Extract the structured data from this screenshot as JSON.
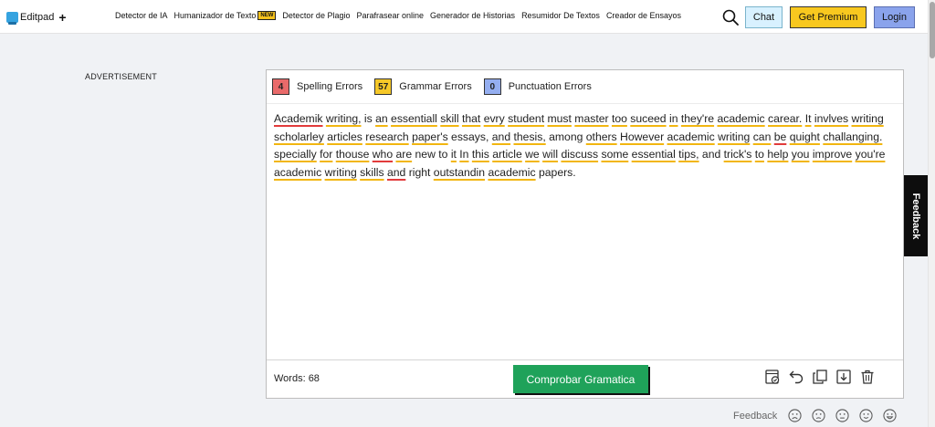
{
  "nav": {
    "logo_text": "Editpad",
    "plus": "+",
    "links": [
      "Detector de IA",
      "Humanizador de Texto"
    ],
    "new_badge": "NEW",
    "links_after": [
      "Detector de Plagio",
      "Parafrasear online",
      "Generador de Historias",
      "Resumidor De Textos",
      "Creador de Ensayos"
    ],
    "chat": "Chat",
    "premium": "Get Premium",
    "login": "Login"
  },
  "ad_label": "ADVERTISEMENT",
  "counts": {
    "spelling": {
      "value": "4",
      "label": "Spelling Errors"
    },
    "grammar": {
      "value": "57",
      "label": "Grammar Errors"
    },
    "punctuation": {
      "value": "0",
      "label": "Punctuation Errors"
    }
  },
  "editor": {
    "tokens": [
      {
        "t": "Academik",
        "m": "s"
      },
      {
        "t": " "
      },
      {
        "t": "writing,",
        "m": "g"
      },
      {
        "t": " is "
      },
      {
        "t": "an",
        "m": "g"
      },
      {
        "t": " "
      },
      {
        "t": "essentiall",
        "m": "g"
      },
      {
        "t": " "
      },
      {
        "t": "skill",
        "m": "g"
      },
      {
        "t": " "
      },
      {
        "t": "that",
        "m": "g"
      },
      {
        "t": " "
      },
      {
        "t": "evry",
        "m": "g"
      },
      {
        "t": " "
      },
      {
        "t": "student",
        "m": "g"
      },
      {
        "t": " "
      },
      {
        "t": "must",
        "m": "g"
      },
      {
        "t": " "
      },
      {
        "t": "master",
        "m": "g"
      },
      {
        "t": " "
      },
      {
        "t": "too",
        "m": "g"
      },
      {
        "t": " "
      },
      {
        "t": "suceed",
        "m": "g"
      },
      {
        "t": " "
      },
      {
        "t": "in",
        "m": "g"
      },
      {
        "t": " "
      },
      {
        "t": "they're",
        "m": "g"
      },
      {
        "t": " "
      },
      {
        "t": "academic",
        "m": "g"
      },
      {
        "t": " "
      },
      {
        "t": "carear.",
        "m": "g"
      },
      {
        "t": " "
      },
      {
        "t": "It",
        "m": "g"
      },
      {
        "t": " "
      },
      {
        "t": "invlves",
        "m": "g"
      },
      {
        "t": " "
      },
      {
        "t": "writing",
        "m": "g"
      },
      {
        "t": " "
      },
      {
        "t": "scholarley",
        "m": "g"
      },
      {
        "t": " "
      },
      {
        "t": "articles",
        "m": "g"
      },
      {
        "t": " "
      },
      {
        "t": "research",
        "m": "g"
      },
      {
        "t": " "
      },
      {
        "t": "paper's",
        "m": "g"
      },
      {
        "t": " essays, "
      },
      {
        "t": "and",
        "m": "g"
      },
      {
        "t": " "
      },
      {
        "t": "thesis,",
        "m": "g"
      },
      {
        "t": " among "
      },
      {
        "t": "others",
        "m": "g"
      },
      {
        "t": " "
      },
      {
        "t": "However",
        "m": "g"
      },
      {
        "t": " "
      },
      {
        "t": "academic",
        "m": "g"
      },
      {
        "t": " "
      },
      {
        "t": "writing",
        "m": "g"
      },
      {
        "t": " "
      },
      {
        "t": "can",
        "m": "g"
      },
      {
        "t": " "
      },
      {
        "t": "be",
        "m": "s"
      },
      {
        "t": " "
      },
      {
        "t": "quight",
        "m": "g"
      },
      {
        "t": " "
      },
      {
        "t": "challanging.",
        "m": "g"
      },
      {
        "t": " "
      },
      {
        "t": "specially",
        "m": "g"
      },
      {
        "t": " "
      },
      {
        "t": "for",
        "m": "g"
      },
      {
        "t": " "
      },
      {
        "t": "thouse",
        "m": "g"
      },
      {
        "t": " "
      },
      {
        "t": "who",
        "m": "s"
      },
      {
        "t": " "
      },
      {
        "t": "are",
        "m": "g"
      },
      {
        "t": " new to "
      },
      {
        "t": "it",
        "m": "g"
      },
      {
        "t": " "
      },
      {
        "t": "In",
        "m": "g"
      },
      {
        "t": " "
      },
      {
        "t": "this",
        "m": "g"
      },
      {
        "t": " "
      },
      {
        "t": "article",
        "m": "g"
      },
      {
        "t": " "
      },
      {
        "t": "we",
        "m": "g"
      },
      {
        "t": " "
      },
      {
        "t": "will",
        "m": "g"
      },
      {
        "t": " "
      },
      {
        "t": "discuss",
        "m": "g"
      },
      {
        "t": " "
      },
      {
        "t": "some",
        "m": "g"
      },
      {
        "t": " "
      },
      {
        "t": "essential",
        "m": "g"
      },
      {
        "t": " "
      },
      {
        "t": "tips,",
        "m": "g"
      },
      {
        "t": " and "
      },
      {
        "t": "trick's",
        "m": "g"
      },
      {
        "t": " "
      },
      {
        "t": "to",
        "m": "g"
      },
      {
        "t": " "
      },
      {
        "t": "help",
        "m": "g"
      },
      {
        "t": " "
      },
      {
        "t": "you",
        "m": "g"
      },
      {
        "t": " "
      },
      {
        "t": "improve",
        "m": "g"
      },
      {
        "t": " "
      },
      {
        "t": "you're",
        "m": "g"
      },
      {
        "t": " "
      },
      {
        "t": "academic",
        "m": "g"
      },
      {
        "t": " "
      },
      {
        "t": "writing",
        "m": "g"
      },
      {
        "t": " "
      },
      {
        "t": "skills",
        "m": "g"
      },
      {
        "t": " "
      },
      {
        "t": "and",
        "m": "s"
      },
      {
        "t": " right "
      },
      {
        "t": "outstandin",
        "m": "g"
      },
      {
        "t": " "
      },
      {
        "t": "academic",
        "m": "g"
      },
      {
        "t": " papers."
      }
    ],
    "words_label": "Words: 68",
    "check_button": "Comprobar Gramatica"
  },
  "tools": [
    "check-document-icon",
    "undo-icon",
    "copy-icon",
    "download-icon",
    "trash-icon"
  ],
  "feedback_tab": "Feedback",
  "feedback_row": {
    "label": "Feedback",
    "faces": [
      "very-sad-face-icon",
      "sad-face-icon",
      "neutral-face-icon",
      "happy-face-icon",
      "very-happy-face-icon"
    ]
  },
  "colors": {
    "spelling": "#e96a6a",
    "grammar": "#f6c828",
    "punctuation": "#94aef0",
    "check_button": "#1fa25a",
    "premium": "#f8c81f",
    "login": "#8aa3ec",
    "chat": "#d8f1ff"
  }
}
